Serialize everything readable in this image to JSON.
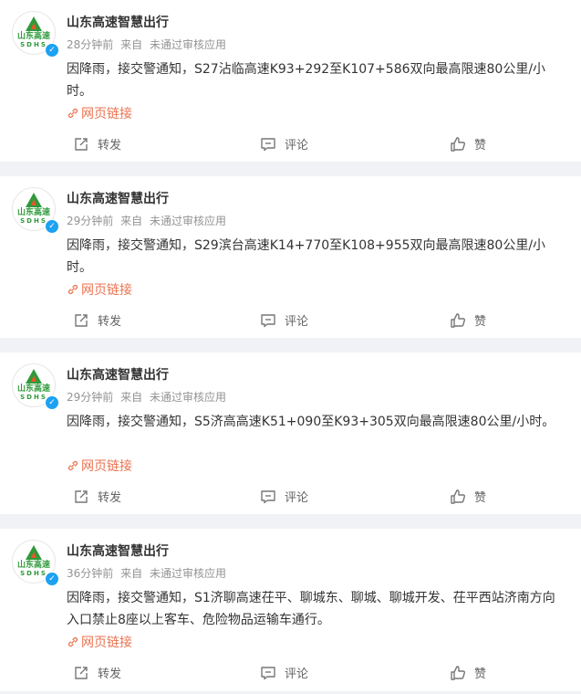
{
  "posts": [
    {
      "author": "山东高速智慧出行",
      "time": "28分钟前",
      "source_prefix": "来自",
      "source": "未通过审核应用",
      "text": "因降雨，接交警通知，S27沾临高速K93+292至K107+586双向最高限速80公里/小时。",
      "link": "网页链接",
      "repost": "转发",
      "comment": "评论",
      "like": "赞"
    },
    {
      "author": "山东高速智慧出行",
      "time": "29分钟前",
      "source_prefix": "来自",
      "source": "未通过审核应用",
      "text": "因降雨，接交警通知，S29滨台高速K14+770至K108+955双向最高限速80公里/小时。",
      "link": "网页链接",
      "repost": "转发",
      "comment": "评论",
      "like": "赞"
    },
    {
      "author": "山东高速智慧出行",
      "time": "29分钟前",
      "source_prefix": "来自",
      "source": "未通过审核应用",
      "text": "因降雨，接交警通知，S5济高高速K51+090至K93+305双向最高限速80公里/小时。",
      "link": "网页链接",
      "repost": "转发",
      "comment": "评论",
      "like": "赞"
    },
    {
      "author": "山东高速智慧出行",
      "time": "36分钟前",
      "source_prefix": "来自",
      "source": "未通过审核应用",
      "text": "因降雨，接交警通知，S1济聊高速茌平、聊城东、聊城、聊城开发、茌平西站济南方向入口禁止8座以上客车、危险物品运输车通行。",
      "link": "网页链接",
      "repost": "转发",
      "comment": "评论",
      "like": "赞"
    }
  ],
  "avatar": {
    "logo_cn": "山东高速",
    "logo_en": "SDHS"
  },
  "colors": {
    "link": "#eb7350",
    "verified": "#1da1f2",
    "brand_green": "#2e9a3a"
  }
}
